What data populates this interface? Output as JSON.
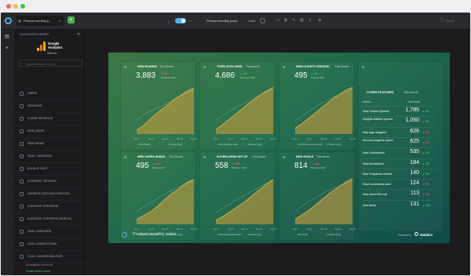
{
  "topbar": {
    "board_name": "Product monthly p...",
    "board_title": "Product monthly pulse",
    "color_label": "Color",
    "status": "Saved"
  },
  "sidebar": {
    "header": "DATASOURCE LIBRARY",
    "brand_name": "Google Analytics",
    "brand_sub": "Website",
    "search_placeholder": "Search Datasource Library",
    "items": [
      "USERS",
      "SESSIONS",
      "% NEW SESSIONS",
      "NEW USERS",
      "PAGEVIEWS",
      "PAGE / SESSIONS",
      "BOUNCE RATE",
      "SCREENS / SESSION",
      "AVERAGE SESSION DURATION",
      "AUDIENCE OVERVIEW",
      "AUDIENCE OVERVIEW (MOBILE)",
      "GOAL OVERVIEW",
      "GOAL COMPLETIONS",
      "GOAL CONVERSION RATE"
    ],
    "footer_links": [
      "All available metrics list",
      "Create custom visual"
    ]
  },
  "cards": [
    {
      "title": "NEW BOARDS",
      "period": "This Month",
      "value": "3,883",
      "change": "1%",
      "dir": "down",
      "prev": "Previous 3,952",
      "legend": [
        "New Boards",
        "Previous (Avg)"
      ]
    },
    {
      "title": "TEMPLATES USED",
      "period": "This Month",
      "value": "4,686",
      "change": "1%",
      "dir": "up",
      "prev": "Previous 4,632",
      "legend": [
        "New Templates Used",
        "Previous (Avg)"
      ]
    },
    {
      "title": "NEW CLIENTS CREATED",
      "period": "This Month",
      "value": "495",
      "change": "2%",
      "dir": "up",
      "prev": "Previous 484",
      "legend": [
        "New clients account added",
        "Previous (Avg)"
      ]
    },
    {
      "title": "NEW USERS ADDED",
      "period": "This Month",
      "value": "495",
      "change": "19%",
      "dir": "down",
      "prev": "Previous 611",
      "legend": [
        "Public New Link clicks",
        "Previous (Avg)"
      ]
    },
    {
      "title": "SCORECARDS SET UP",
      "period": "This Month",
      "value": "558",
      "change": "47%",
      "dir": "down",
      "prev": "Previous 1,048",
      "legend": [
        "Total Scorecards Created",
        "Previous (Avg)"
      ]
    },
    {
      "title": "NEW GOALS",
      "period": "This Month",
      "value": "814",
      "change": "23%",
      "dir": "down",
      "prev": "Previous 1,052",
      "legend": [
        "New Goals",
        "Previous (Avg)"
      ]
    }
  ],
  "axis_labels": [
    "Sep 1",
    "Sep 8",
    "Sep 15",
    "Sep 22",
    "Sep 29"
  ],
  "other_features": {
    "title": "OTHER FEATURES",
    "period": "This Month",
    "col_metrics": "Metrics",
    "col_month": "This Month",
    "rows": [
      {
        "name": "New Custom Queries",
        "value": "1,785",
        "change": "5%",
        "dir": "up"
      },
      {
        "name": "Insights sidebar opened",
        "value": "1,050",
        "change": "6%",
        "dir": "up"
      },
      {
        "name": "New tags assigned",
        "value": "626",
        "change": "6%",
        "dir": "down"
      },
      {
        "name": "Account progress opens",
        "value": "625",
        "change": "5%",
        "dir": "down"
      },
      {
        "name": "New Calculations",
        "value": "535",
        "change": "4%",
        "dir": "up"
      },
      {
        "name": "New Annotations",
        "value": "184",
        "change": "4%",
        "dir": "up"
      },
      {
        "name": "New Snapshots shared",
        "value": "140",
        "change": "5%",
        "dir": "up"
      },
      {
        "name": "Slack commands used",
        "value": "124",
        "change": "5%",
        "dir": "down"
      },
      {
        "name": "New client KPIs set",
        "value": "113",
        "change": "2%",
        "dir": "down"
      },
      {
        "name": "New Alerts",
        "value": "131",
        "change": "14%",
        "dir": "up"
      }
    ]
  },
  "footer": {
    "board_title": "Product monthly pulse",
    "powered_by": "Powered by",
    "brand": "databox"
  },
  "colors": {
    "up": "#3fd46c",
    "down": "#f2556c",
    "area": "#d6a23a",
    "line": "#f0b64a"
  }
}
